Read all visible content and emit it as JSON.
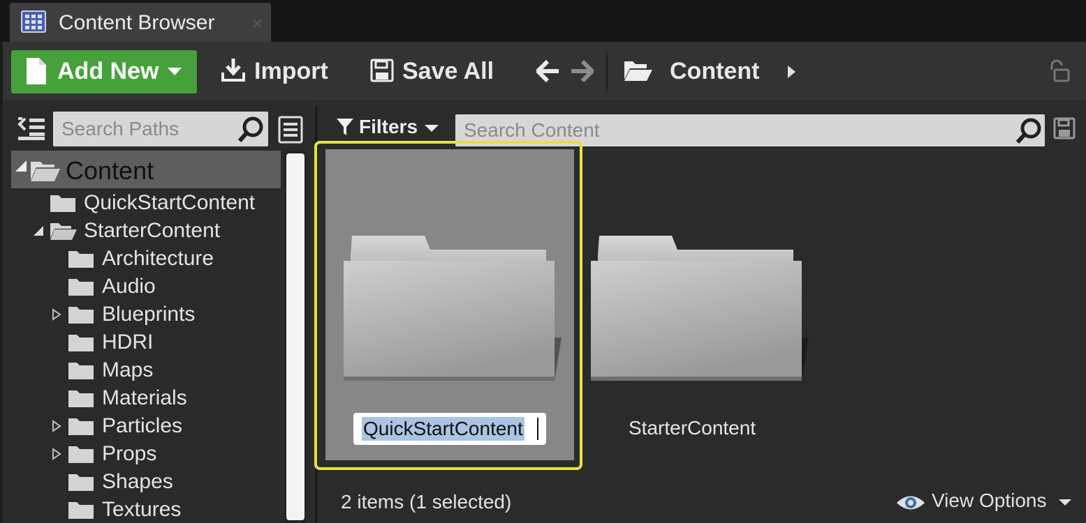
{
  "tab": {
    "title": "Content Browser",
    "close": "✕"
  },
  "toolbar": {
    "add_new": "Add New",
    "import": "Import",
    "save_all": "Save All",
    "breadcrumb": "Content"
  },
  "sources": {
    "search_placeholder": "Search Paths",
    "tree": [
      {
        "label": "Content",
        "expanded": true,
        "selected": true
      },
      {
        "label": "QuickStartContent"
      },
      {
        "label": "StarterContent",
        "expanded": true
      },
      {
        "label": "Architecture"
      },
      {
        "label": "Audio"
      },
      {
        "label": "Blueprints",
        "collapsed": true
      },
      {
        "label": "HDRI"
      },
      {
        "label": "Maps"
      },
      {
        "label": "Materials"
      },
      {
        "label": "Particles",
        "collapsed": true
      },
      {
        "label": "Props",
        "collapsed": true
      },
      {
        "label": "Shapes"
      },
      {
        "label": "Textures"
      }
    ]
  },
  "content": {
    "filters_label": "Filters",
    "search_placeholder": "Search Content",
    "items": [
      {
        "name": "QuickStartContent",
        "selected": true,
        "renaming": true
      },
      {
        "name": "StarterContent"
      }
    ],
    "status": "2 items (1 selected)",
    "view_options": "View Options"
  },
  "colors": {
    "accent_green": "#46a13c",
    "selection_yellow": "#e8e23a",
    "text_selection": "#a9c4e4"
  }
}
